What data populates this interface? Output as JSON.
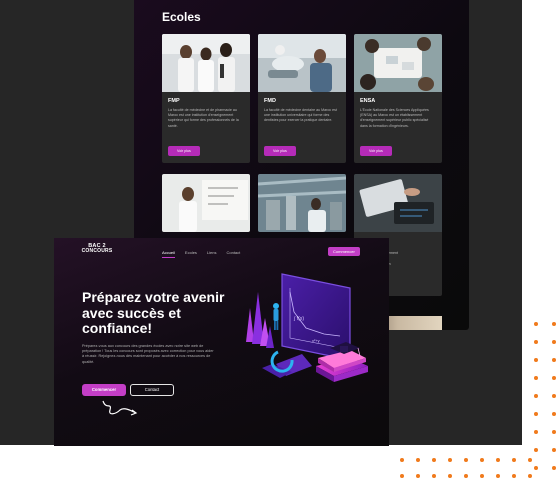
{
  "ecoles_section": {
    "title": "Ecoles",
    "cards": [
      {
        "title": "FMP",
        "text": "La faculté de médecine et de pharmacie au Maroc est une institution d'enseignement supérieur qui forme des professionnels de la santé.",
        "button": "Voir plus"
      },
      {
        "title": "FMD",
        "text": "La faculté de médecine dentaire au Maroc est une institution universitaire qui forme des dentistes pour exercer la pratique dentaire.",
        "button": "Voir plus"
      },
      {
        "title": "ENSA",
        "text": "L'École Nationale des Sciences Appliquées (ENSA) au Maroc est un établissement d'enseignement supérieur public spécialisé dans la formation d'ingénieurs.",
        "button": "Voir plus"
      },
      {
        "title": "",
        "text": "",
        "button": ""
      },
      {
        "title": "",
        "text": "",
        "button": ""
      },
      {
        "title": "",
        "text": "",
        "button": ""
      }
    ],
    "partial_text": [
      "e nationale",
      "ts) est un établissement",
      "e supérieur public",
      "é dans la formation",
      "architectes."
    ]
  },
  "hero_page": {
    "logo_line1": "BAC 2",
    "logo_line2": "CONCOURS",
    "nav": [
      "Accueil",
      "Ecoles",
      "Liens",
      "Contact"
    ],
    "nav_cta": "Commencer",
    "title": "Préparez votre avenir avec succès et confiance!",
    "description": "Préparez-vous aux concours des grandes écoles avec notre site web de préparation ! Tous les concours sont proposés avec correction pour vous aider à réussir. Rejoignez-nous dès maintenant pour accéder à nos ressources de qualité.",
    "primary_button": "Commencer",
    "secondary_button": "Contact"
  },
  "colors": {
    "accent": "#c33ec6",
    "backdrop": "#262626",
    "dots": "#f07a1c"
  },
  "icons": [
    "squiggle-arrow-icon",
    "education-illustration"
  ]
}
